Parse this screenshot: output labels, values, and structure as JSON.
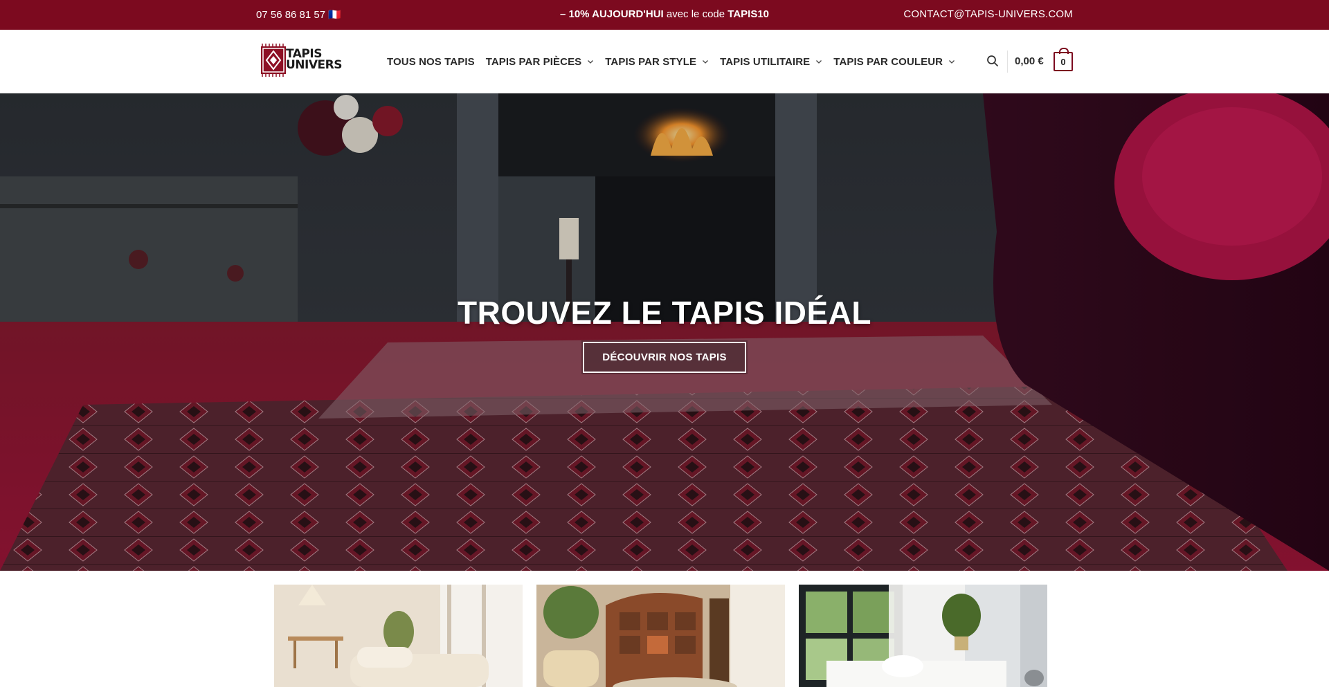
{
  "topbar": {
    "phone": "07 56 86 81 57 🇫🇷",
    "promo_strong": "– 10% AUJOURD'HUI",
    "promo_text": " avec le code ",
    "promo_code": "TAPIS10",
    "email": "CONTACT@TAPIS-UNIVERS.COM"
  },
  "logo": {
    "line1": "TAPIS",
    "line2": "UNIVERS"
  },
  "nav": {
    "items": [
      {
        "label": "TOUS NOS TAPIS",
        "dropdown": false
      },
      {
        "label": "TAPIS PAR PIÈCES",
        "dropdown": true
      },
      {
        "label": "TAPIS PAR STYLE",
        "dropdown": true
      },
      {
        "label": "TAPIS UTILITAIRE",
        "dropdown": true
      },
      {
        "label": "TAPIS PAR COULEUR",
        "dropdown": true
      }
    ]
  },
  "cart": {
    "total": "0,00 €",
    "count": "0"
  },
  "hero": {
    "title": "TROUVEZ LE TAPIS IDÉAL",
    "button": "DÉCOUVRIR NOS TAPIS"
  },
  "icons": {
    "search": "search-icon",
    "chevron": "chevron-down-icon",
    "cart": "shopping-bag-icon"
  },
  "colors": {
    "brand": "#7c0a1f",
    "text": "#2a2a2a",
    "white": "#ffffff"
  }
}
